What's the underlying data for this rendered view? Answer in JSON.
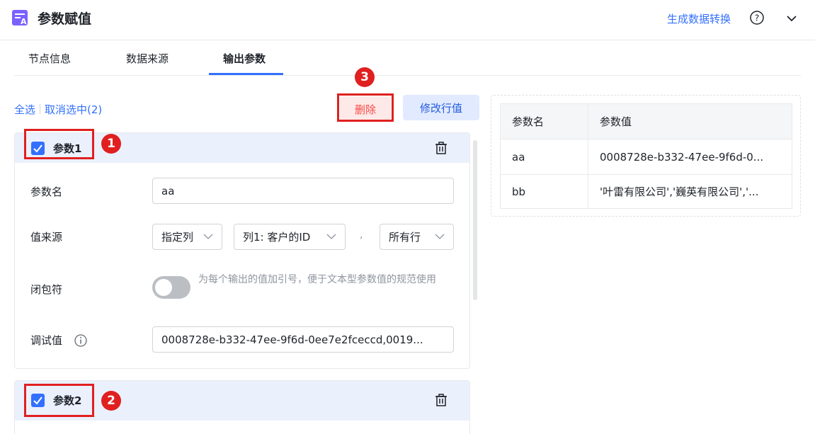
{
  "header": {
    "title": "参数赋值",
    "app_icon": "parameter-assign-icon",
    "convert_link": "生成数据转换",
    "help_icon": "help-circle-icon",
    "collapse_icon": "chevron-down-icon"
  },
  "tabs": [
    {
      "label": "节点信息",
      "active": false
    },
    {
      "label": "数据来源",
      "active": false
    },
    {
      "label": "输出参数",
      "active": true
    }
  ],
  "toolbar": {
    "select_all": "全选",
    "deselect": "取消选中(2)",
    "delete_label": "删除",
    "edit_row_label": "修改行值"
  },
  "markers": [
    "1",
    "2",
    "3"
  ],
  "params": [
    {
      "title": "参数1",
      "checked": true,
      "name_label": "参数名",
      "name_value": "aa",
      "source_label": "值来源",
      "source_type": "指定列",
      "source_column": "列1: 客户的ID",
      "separator": ",",
      "source_rows": "所有行",
      "wrap_label": "闭包符",
      "wrap_enabled": false,
      "wrap_desc": "为每个输出的值加引号，便于文本型参数值的规范使用",
      "debug_label": "调试值",
      "debug_info_icon": "info-icon",
      "debug_value": "0008728e-b332-47ee-9f6d-0ee7e2fceccd,0019..."
    },
    {
      "title": "参数2",
      "checked": true
    }
  ],
  "result_table": {
    "headers": [
      "参数名",
      "参数值"
    ],
    "rows": [
      [
        "aa",
        "0008728e-b332-47ee-9f6d-0..."
      ],
      [
        "bb",
        "'叶雷有限公司','巍英有限公司','..."
      ]
    ]
  },
  "colors": {
    "accent": "#3370ff",
    "danger": "#f54a45",
    "highlight_box": "#e02020",
    "card_header_bg": "#ebf0fd"
  }
}
